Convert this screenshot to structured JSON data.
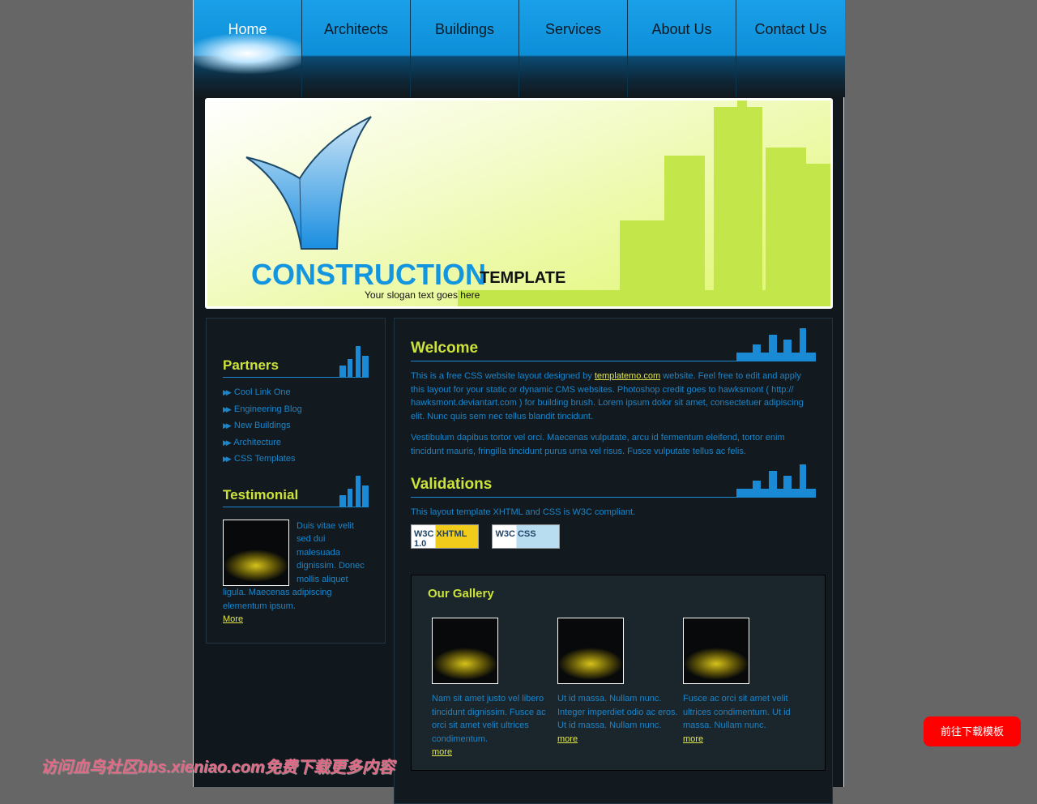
{
  "nav": [
    "Home",
    "Architects",
    "Buildings",
    "Services",
    "About Us",
    "Contact Us"
  ],
  "banner": {
    "title": "CONSTRUCTION",
    "subtitle": "TEMPLATE",
    "slogan": "Your slogan text goes here"
  },
  "partners": {
    "title": "Partners",
    "links": [
      "Cool Link One",
      "Engineering Blog",
      "New Buildings",
      "Architecture",
      "CSS Templates"
    ]
  },
  "testimonial": {
    "title": "Testimonial",
    "text": "Duis vitae velit sed dui malesuada dignissim. Donec mollis aliquet ligula. Maecenas adipiscing elementum ipsum.",
    "more": "More"
  },
  "welcome": {
    "title": "Welcome",
    "p1_before": "This is a free CSS website layout designed by ",
    "p1_link": "templatemo.com",
    "p1_after": " website. Feel free to edit and apply this layout for your static or dynamic CMS websites. Photoshop credit goes to hawksmont ( http:// hawksmont.deviantart.com ) for building brush. Lorem ipsum dolor sit amet, consectetuer adipiscing elit. Nunc quis sem nec tellus blandit tincidunt.",
    "p2": "Vestibulum dapibus tortor vel orci. Maecenas vulputate, arcu id fermentum eleifend, tortor enim tincidunt mauris, fringilla tincidunt purus urna vel risus. Fusce vulputate tellus ac felis."
  },
  "validations": {
    "title": "Validations",
    "text": "This layout template XHTML and CSS is W3C compliant.",
    "badges": [
      "W3C XHTML 1.0",
      "W3C CSS"
    ]
  },
  "gallery": {
    "title": "Our Gallery",
    "items": [
      {
        "text": "Nam sit amet justo vel libero tincidunt dignissim. Fusce ac orci sit amet velit ultrices condimentum.",
        "more": "more"
      },
      {
        "text": "Ut id massa. Nullam nunc. Integer imperdiet odio ac eros. Ut id massa. Nullam nunc.",
        "more": "more"
      },
      {
        "text": "Fusce ac orci sit amet velit ultrices condimentum. Ut id massa. Nullam nunc.",
        "more": "more"
      }
    ]
  },
  "watermark": "访问血鸟社区bbs.xieniao.com免费下载更多内容",
  "download_button": "前往下载模板"
}
